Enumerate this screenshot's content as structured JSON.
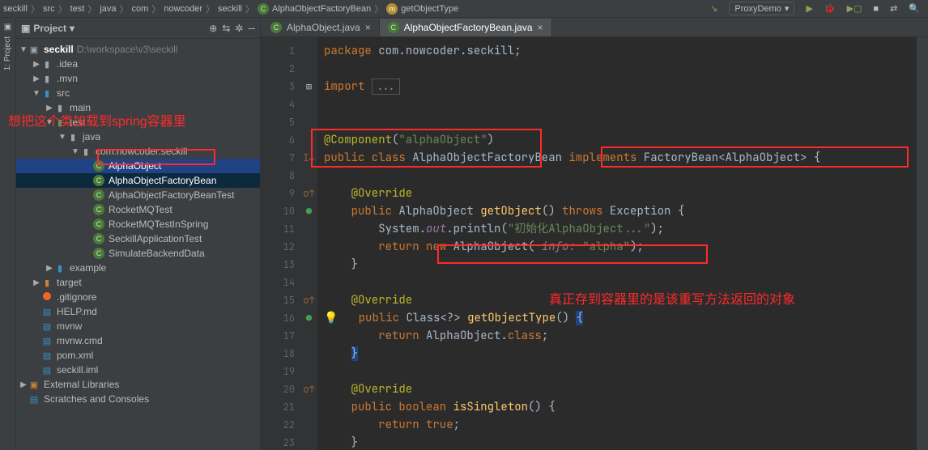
{
  "breadcrumb": [
    "seckill",
    "src",
    "test",
    "java",
    "com",
    "nowcoder",
    "seckill",
    "AlphaObjectFactoryBean",
    "getObjectType"
  ],
  "run_config": "ProxyDemo",
  "project": {
    "title": "Project",
    "root": {
      "name": "seckill",
      "path": "D:\\workspace\\v3\\seckill"
    },
    "items": [
      {
        "ind": 1,
        "arrow": "▶",
        "icon": "folder",
        "label": ".idea"
      },
      {
        "ind": 1,
        "arrow": "▶",
        "icon": "folder",
        "label": ".mvn"
      },
      {
        "ind": 1,
        "arrow": "▼",
        "icon": "folder-blue",
        "label": "src"
      },
      {
        "ind": 2,
        "arrow": "▶",
        "icon": "folder",
        "label": "main"
      },
      {
        "ind": 2,
        "arrow": "▼",
        "icon": "folder-green",
        "label": "test"
      },
      {
        "ind": 3,
        "arrow": "▼",
        "icon": "folder",
        "label": "java"
      },
      {
        "ind": 4,
        "arrow": "▼",
        "icon": "folder",
        "label": "com.nowcoder.seckill"
      },
      {
        "ind": 5,
        "arrow": "",
        "icon": "class",
        "label": "AlphaObject",
        "sel": "hl"
      },
      {
        "ind": 5,
        "arrow": "",
        "icon": "class",
        "label": "AlphaObjectFactoryBean",
        "sel": "selected"
      },
      {
        "ind": 5,
        "arrow": "",
        "icon": "class",
        "label": "AlphaObjectFactoryBeanTest"
      },
      {
        "ind": 5,
        "arrow": "",
        "icon": "class",
        "label": "RocketMQTest"
      },
      {
        "ind": 5,
        "arrow": "",
        "icon": "class",
        "label": "RocketMQTestInSpring"
      },
      {
        "ind": 5,
        "arrow": "",
        "icon": "class",
        "label": "SeckillApplicationTest"
      },
      {
        "ind": 5,
        "arrow": "",
        "icon": "class",
        "label": "SimulateBackendData"
      },
      {
        "ind": 2,
        "arrow": "▶",
        "icon": "folder-blue",
        "label": "example"
      },
      {
        "ind": 1,
        "arrow": "▶",
        "icon": "folder-orange",
        "label": "target"
      },
      {
        "ind": 1,
        "arrow": "",
        "icon": "dot-orange",
        "label": ".gitignore"
      },
      {
        "ind": 1,
        "arrow": "",
        "icon": "azure",
        "label": "HELP.md"
      },
      {
        "ind": 1,
        "arrow": "",
        "icon": "azure",
        "label": "mvnw"
      },
      {
        "ind": 1,
        "arrow": "",
        "icon": "azure",
        "label": "mvnw.cmd"
      },
      {
        "ind": 1,
        "arrow": "",
        "icon": "azure",
        "label": "pom.xml"
      },
      {
        "ind": 1,
        "arrow": "",
        "icon": "azure",
        "label": "seckill.iml"
      }
    ],
    "ext_lib": "External Libraries",
    "scratches": "Scratches and Consoles"
  },
  "tabs": [
    {
      "label": "AlphaObject.java",
      "active": false
    },
    {
      "label": "AlphaObjectFactoryBean.java",
      "active": true
    }
  ],
  "code": {
    "lines": [
      1,
      2,
      3,
      4,
      5,
      6,
      7,
      8,
      9,
      10,
      11,
      12,
      13,
      14,
      15,
      16,
      17,
      18,
      19,
      20,
      21,
      22,
      23
    ],
    "pkg": "package com.nowcoder.seckill;",
    "imp": "import ...",
    "ann": "@Component",
    "ann_arg": "\"alphaObject\"",
    "cls_decl": {
      "pub": "public class ",
      "name": "AlphaObjectFactoryBean ",
      "impl": "implements ",
      "iface": "FactoryBean<AlphaObject> {"
    },
    "ovr": "@Override",
    "m1": {
      "sig": "public AlphaObject getObject() throws Exception {",
      "l1": "System.out.println(\"初始化AlphaObject...\");",
      "l2": "return new AlphaObject( info: \"alpha\");"
    },
    "m2": {
      "sig": "public Class<?> getObjectType() {",
      "l1": "return AlphaObject.class;"
    },
    "m3": {
      "sig": "public boolean isSingleton() {",
      "l1": "return true;"
    }
  },
  "annotations": {
    "left": "想把这个类加载到spring容器里",
    "right": "真正存到容器里的是该重写方法返回的对象"
  }
}
